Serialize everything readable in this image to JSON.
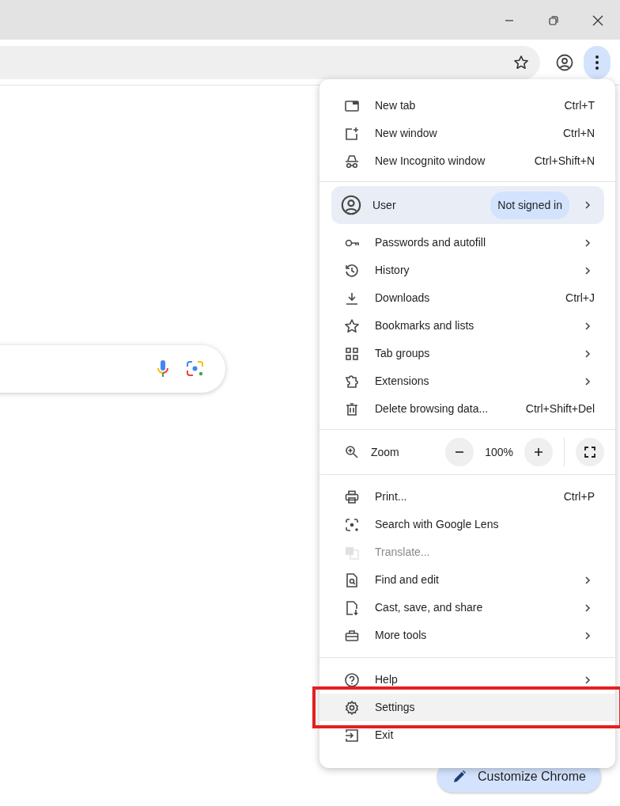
{
  "toolbar": {
    "menu_open": true
  },
  "menu": {
    "sections": [
      {
        "items": [
          {
            "kind": "item",
            "label": "New tab",
            "shortcut": "Ctrl+T",
            "submenu": false,
            "disabled": false,
            "highlighted": false
          },
          {
            "kind": "item",
            "label": "New window",
            "shortcut": "Ctrl+N",
            "submenu": false,
            "disabled": false,
            "highlighted": false
          },
          {
            "kind": "item",
            "label": "New Incognito window",
            "shortcut": "Ctrl+Shift+N",
            "submenu": false,
            "disabled": false,
            "highlighted": false
          }
        ]
      },
      {
        "items": [
          {
            "kind": "profile",
            "label": "User",
            "status": "Not signed in",
            "submenu": true
          },
          {
            "kind": "item",
            "label": "Passwords and autofill",
            "submenu": true,
            "disabled": false,
            "highlighted": false
          },
          {
            "kind": "item",
            "label": "History",
            "submenu": true,
            "disabled": false,
            "highlighted": false
          },
          {
            "kind": "item",
            "label": "Downloads",
            "shortcut": "Ctrl+J",
            "submenu": false,
            "disabled": false,
            "highlighted": false
          },
          {
            "kind": "item",
            "label": "Bookmarks and lists",
            "submenu": true,
            "disabled": false,
            "highlighted": false
          },
          {
            "kind": "item",
            "label": "Tab groups",
            "submenu": true,
            "disabled": false,
            "highlighted": false
          },
          {
            "kind": "item",
            "label": "Extensions",
            "submenu": true,
            "disabled": false,
            "highlighted": false
          },
          {
            "kind": "item",
            "label": "Delete browsing data...",
            "shortcut": "Ctrl+Shift+Del",
            "submenu": false,
            "disabled": false,
            "highlighted": false
          }
        ]
      },
      {
        "items": [
          {
            "kind": "zoom",
            "label": "Zoom",
            "value": "100%"
          }
        ]
      },
      {
        "items": [
          {
            "kind": "item",
            "label": "Print...",
            "shortcut": "Ctrl+P",
            "submenu": false,
            "disabled": false,
            "highlighted": false
          },
          {
            "kind": "item",
            "label": "Search with Google Lens",
            "submenu": false,
            "disabled": false,
            "highlighted": false
          },
          {
            "kind": "item",
            "label": "Translate...",
            "submenu": false,
            "disabled": true,
            "highlighted": false
          },
          {
            "kind": "item",
            "label": "Find and edit",
            "submenu": true,
            "disabled": false,
            "highlighted": false
          },
          {
            "kind": "item",
            "label": "Cast, save, and share",
            "submenu": true,
            "disabled": false,
            "highlighted": false
          },
          {
            "kind": "item",
            "label": "More tools",
            "submenu": true,
            "disabled": false,
            "highlighted": false
          }
        ]
      },
      {
        "items": [
          {
            "kind": "item",
            "label": "Help",
            "submenu": true,
            "disabled": false,
            "highlighted": false
          },
          {
            "kind": "item",
            "label": "Settings",
            "submenu": false,
            "disabled": false,
            "highlighted": true
          },
          {
            "kind": "item",
            "label": "Exit",
            "submenu": false,
            "disabled": false,
            "highlighted": false
          }
        ]
      }
    ]
  },
  "customize_button": {
    "label": "Customize Chrome"
  }
}
